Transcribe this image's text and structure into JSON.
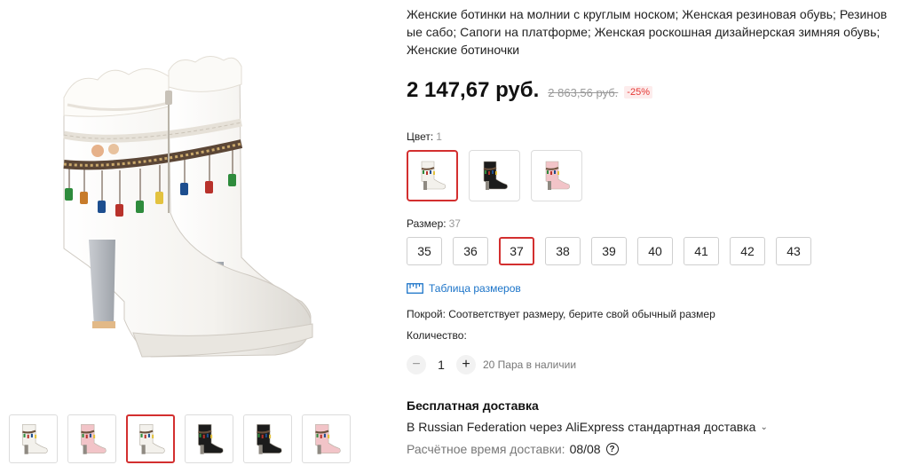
{
  "product": {
    "title": "Женские ботинки на молнии с круглым носком; Женская резиновая обувь; Резиновые сабо; Сапоги на платформе; Женская роскошная дизайнерская зимняя обувь; Женские ботиночки",
    "price": "2 147,67 руб.",
    "old_price": "2 863,56 руб.",
    "discount": "-25%"
  },
  "color": {
    "label": "Цвет:",
    "selected": "1",
    "options": [
      {
        "icon": "white-boot-image",
        "boot_color": "#f3f1ec"
      },
      {
        "icon": "black-boot-image",
        "boot_color": "#1c1c1c"
      },
      {
        "icon": "pink-boot-image",
        "boot_color": "#f2c4c8"
      }
    ]
  },
  "size": {
    "label": "Размер:",
    "selected": "37",
    "options": [
      "35",
      "36",
      "37",
      "38",
      "39",
      "40",
      "41",
      "42",
      "43"
    ],
    "table_link": "Таблица размеров",
    "fit": "Покрой: Соответствует размеру, берите свой обычный размер"
  },
  "quantity": {
    "label": "Количество:",
    "minus": "−",
    "value": "1",
    "plus": "+",
    "stock": "20 Пара в наличии"
  },
  "shipping": {
    "title": "Бесплатная доставка",
    "route": "В Russian Federation через AliExpress стандартная доставка",
    "chevron": "⌄",
    "eta_label": "Расчётное время доставки:",
    "eta_date": "08/08",
    "help": "?"
  },
  "gallery": {
    "thumbnails": [
      {
        "icon": "white-boot-thumbnail",
        "boot_color": "#f3f1ec"
      },
      {
        "icon": "pink-boot-thumbnail",
        "boot_color": "#f2c4c8"
      },
      {
        "icon": "white-boot-thumbnail",
        "boot_color": "#f3f1ec"
      },
      {
        "icon": "black-boot-thumbnail",
        "boot_color": "#1c1c1c"
      },
      {
        "icon": "black-white-pink-boots-thumbnail",
        "boot_color": "#1c1c1c"
      },
      {
        "icon": "pink-boot-detail-thumbnail",
        "boot_color": "#f2c4c8"
      }
    ],
    "active_index": 2
  },
  "colors": {
    "accent": "#d32f2f",
    "link": "#1a73c8",
    "discount_red": "#e53935"
  }
}
